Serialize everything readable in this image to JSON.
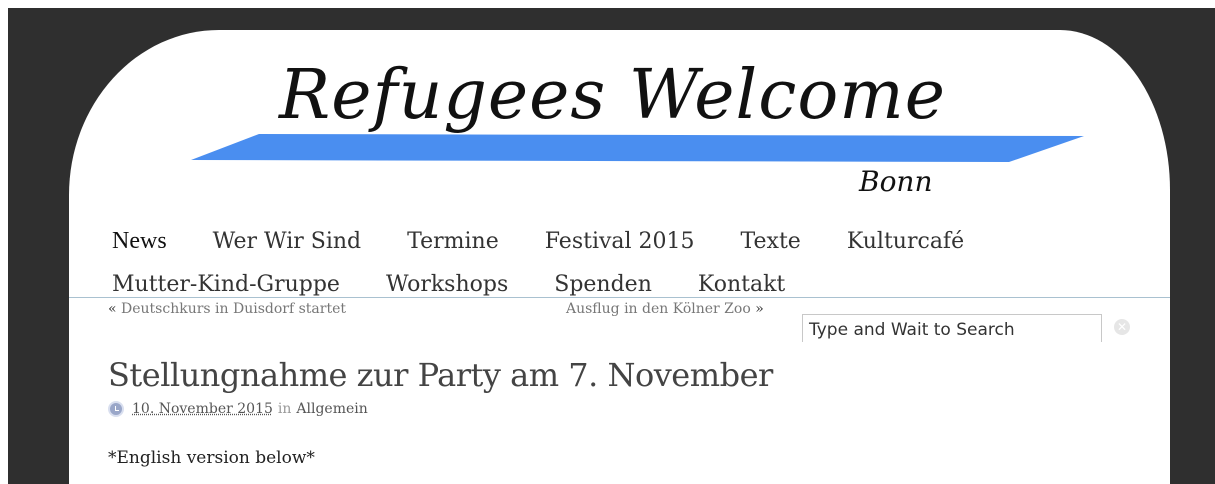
{
  "logo": {
    "title": "Refugees Welcome",
    "subtitle": "Bonn",
    "stripe_color": "#4a8ef0"
  },
  "nav": {
    "row1": [
      "News",
      "Wer Wir Sind",
      "Termine",
      "Festival 2015",
      "Texte",
      "Kulturcafé"
    ],
    "row2": [
      "Mutter-Kind-Gruppe",
      "Workshops",
      "Spenden",
      "Kontakt"
    ]
  },
  "post_nav": {
    "prev_arrow": "«",
    "prev_label": "Deutschkurs in Duisdorf startet",
    "next_label": "Ausflug in den Kölner Zoo",
    "next_arrow": "»"
  },
  "search": {
    "placeholder": "Type and Wait to Search",
    "clear_icon": "close-circle-icon"
  },
  "post": {
    "title": "Stellungnahme zur Party am 7. November",
    "date": "10. November 2015",
    "in_word": "in",
    "category": "Allgemein",
    "intro": "*English version below*"
  },
  "colors": {
    "frame": "#2f2f2f",
    "divider": "#a9c1d0"
  }
}
